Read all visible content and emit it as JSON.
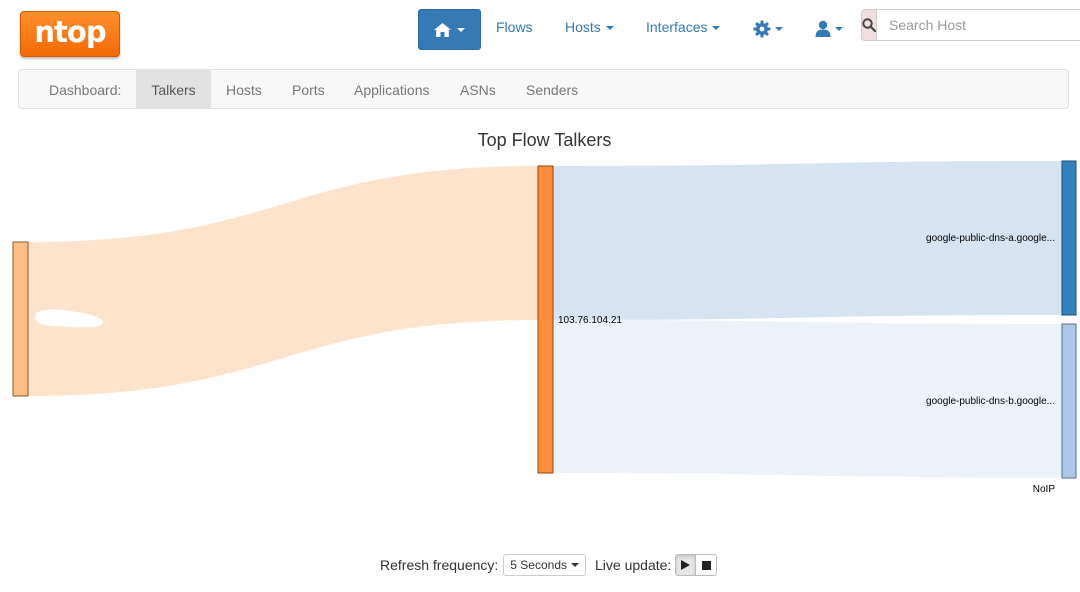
{
  "logo": {
    "text": "ntop"
  },
  "navbar": {
    "home_icon": "home-icon",
    "flows": "Flows",
    "hosts": "Hosts",
    "interfaces": "Interfaces",
    "settings_icon": "gear-icon",
    "user_icon": "user-icon",
    "search": {
      "icon": "search-icon",
      "placeholder": "Search Host"
    }
  },
  "subnav": {
    "label": "Dashboard:",
    "tabs": [
      "Talkers",
      "Hosts",
      "Ports",
      "Applications",
      "ASNs",
      "Senders"
    ],
    "active": "Talkers"
  },
  "chart": {
    "title": "Top Flow Talkers",
    "nodes": [
      {
        "label": "",
        "color": "#fdbe85"
      },
      {
        "label": "103.76.104.21",
        "color": "#fd8d3c"
      },
      {
        "label": "google-public-dns-a.google...",
        "color": "#3182bd"
      },
      {
        "label": "google-public-dns-b.google...",
        "color": "#aec7e8"
      }
    ],
    "link_colors": [
      "#fde3cc",
      "#d6e3f0",
      "#ebf2fa"
    ],
    "truncated_label": "NoIP"
  },
  "footer": {
    "refresh_label": "Refresh frequency:",
    "refresh_value": "5 Seconds",
    "live_label": "Live update:",
    "play_icon": "play-icon",
    "stop_icon": "stop-icon"
  }
}
